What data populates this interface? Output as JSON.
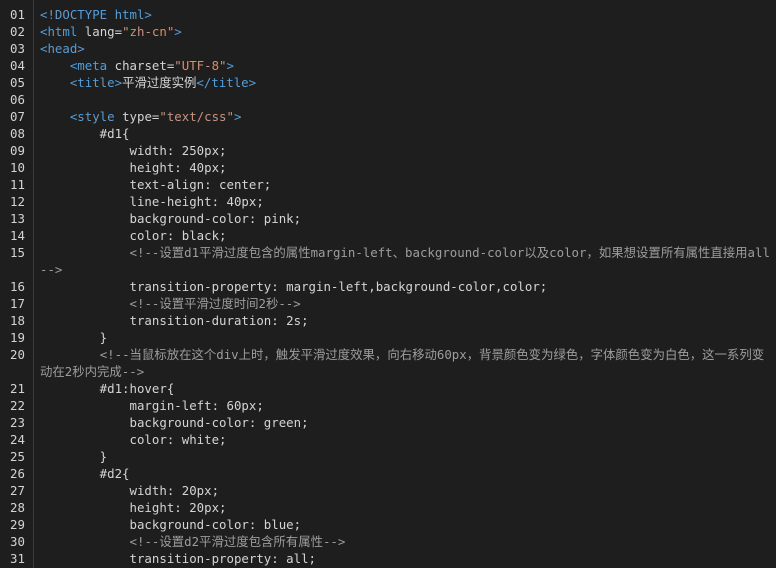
{
  "lines": [
    {
      "n": "01",
      "tokens": [
        {
          "t": "tag",
          "v": "<!DOCTYPE html>"
        }
      ]
    },
    {
      "n": "02",
      "tokens": [
        {
          "t": "tag",
          "v": "<html"
        },
        {
          "t": "attr",
          "v": " lang="
        },
        {
          "t": "str",
          "v": "\"zh-cn\""
        },
        {
          "t": "tag",
          "v": ">"
        }
      ]
    },
    {
      "n": "03",
      "tokens": [
        {
          "t": "tag",
          "v": "<head>"
        }
      ]
    },
    {
      "n": "04",
      "tokens": [
        {
          "t": "plain",
          "v": "    "
        },
        {
          "t": "tag",
          "v": "<meta"
        },
        {
          "t": "attr",
          "v": " charset="
        },
        {
          "t": "str",
          "v": "\"UTF-8\""
        },
        {
          "t": "tag",
          "v": ">"
        }
      ]
    },
    {
      "n": "05",
      "tokens": [
        {
          "t": "plain",
          "v": "    "
        },
        {
          "t": "tag",
          "v": "<title>"
        },
        {
          "t": "plain",
          "v": "平滑过度实例"
        },
        {
          "t": "tag",
          "v": "</title>"
        }
      ]
    },
    {
      "n": "06",
      "tokens": [
        {
          "t": "plain",
          "v": ""
        }
      ]
    },
    {
      "n": "07",
      "tokens": [
        {
          "t": "plain",
          "v": "    "
        },
        {
          "t": "tag",
          "v": "<style"
        },
        {
          "t": "attr",
          "v": " type="
        },
        {
          "t": "str",
          "v": "\"text/css\""
        },
        {
          "t": "tag",
          "v": ">"
        }
      ]
    },
    {
      "n": "08",
      "tokens": [
        {
          "t": "sel",
          "v": "        #d1{"
        }
      ]
    },
    {
      "n": "09",
      "tokens": [
        {
          "t": "plain",
          "v": "            width: 250px;"
        }
      ]
    },
    {
      "n": "10",
      "tokens": [
        {
          "t": "plain",
          "v": "            height: 40px;"
        }
      ]
    },
    {
      "n": "11",
      "tokens": [
        {
          "t": "plain",
          "v": "            text-align: center;"
        }
      ]
    },
    {
      "n": "12",
      "tokens": [
        {
          "t": "plain",
          "v": "            line-height: 40px;"
        }
      ]
    },
    {
      "n": "13",
      "tokens": [
        {
          "t": "plain",
          "v": "            background-color: pink;"
        }
      ]
    },
    {
      "n": "14",
      "tokens": [
        {
          "t": "plain",
          "v": "            color: black;"
        }
      ]
    },
    {
      "n": "15",
      "wrap": true,
      "tokens": [
        {
          "t": "plain",
          "v": "            "
        },
        {
          "t": "cmt",
          "v": "<!--设置d1平滑过度包含的属性margin-left、background-color以及color，如果想设置所有属性直接用all-->"
        }
      ]
    },
    {
      "n": "16",
      "tokens": [
        {
          "t": "plain",
          "v": "            transition-property: margin-left,background-color,color;"
        }
      ]
    },
    {
      "n": "17",
      "tokens": [
        {
          "t": "plain",
          "v": "            "
        },
        {
          "t": "cmt",
          "v": "<!--设置平滑过度时间2秒-->"
        }
      ]
    },
    {
      "n": "18",
      "tokens": [
        {
          "t": "plain",
          "v": "            transition-duration: 2s;"
        }
      ]
    },
    {
      "n": "19",
      "tokens": [
        {
          "t": "plain",
          "v": "        }"
        }
      ]
    },
    {
      "n": "20",
      "wrap": true,
      "tokens": [
        {
          "t": "plain",
          "v": "        "
        },
        {
          "t": "cmt",
          "v": "<!--当鼠标放在这个div上时，触发平滑过度效果，向右移动60px，背景颜色变为绿色，字体颜色变为白色，这一系列变动在2秒内完成-->"
        }
      ]
    },
    {
      "n": "21",
      "tokens": [
        {
          "t": "sel",
          "v": "        #d1:hover{"
        }
      ]
    },
    {
      "n": "22",
      "tokens": [
        {
          "t": "plain",
          "v": "            margin-left: 60px;"
        }
      ]
    },
    {
      "n": "23",
      "tokens": [
        {
          "t": "plain",
          "v": "            background-color: green;"
        }
      ]
    },
    {
      "n": "24",
      "tokens": [
        {
          "t": "plain",
          "v": "            color: white;"
        }
      ]
    },
    {
      "n": "25",
      "tokens": [
        {
          "t": "plain",
          "v": "        }"
        }
      ]
    },
    {
      "n": "26",
      "tokens": [
        {
          "t": "sel",
          "v": "        #d2{"
        }
      ]
    },
    {
      "n": "27",
      "tokens": [
        {
          "t": "plain",
          "v": "            width: 20px;"
        }
      ]
    },
    {
      "n": "28",
      "tokens": [
        {
          "t": "plain",
          "v": "            height: 20px;"
        }
      ]
    },
    {
      "n": "29",
      "tokens": [
        {
          "t": "plain",
          "v": "            background-color: blue;"
        }
      ]
    },
    {
      "n": "30",
      "tokens": [
        {
          "t": "plain",
          "v": "            "
        },
        {
          "t": "cmt",
          "v": "<!--设置d2平滑过度包含所有属性-->"
        }
      ]
    },
    {
      "n": "31",
      "tokens": [
        {
          "t": "plain",
          "v": "            transition-property: all;"
        }
      ]
    }
  ],
  "colors": {
    "background": "#1e1e1e",
    "tag": "#569cd6",
    "string": "#ce9178",
    "comment": "#9d9d9d",
    "text": "#d4d4d4"
  }
}
